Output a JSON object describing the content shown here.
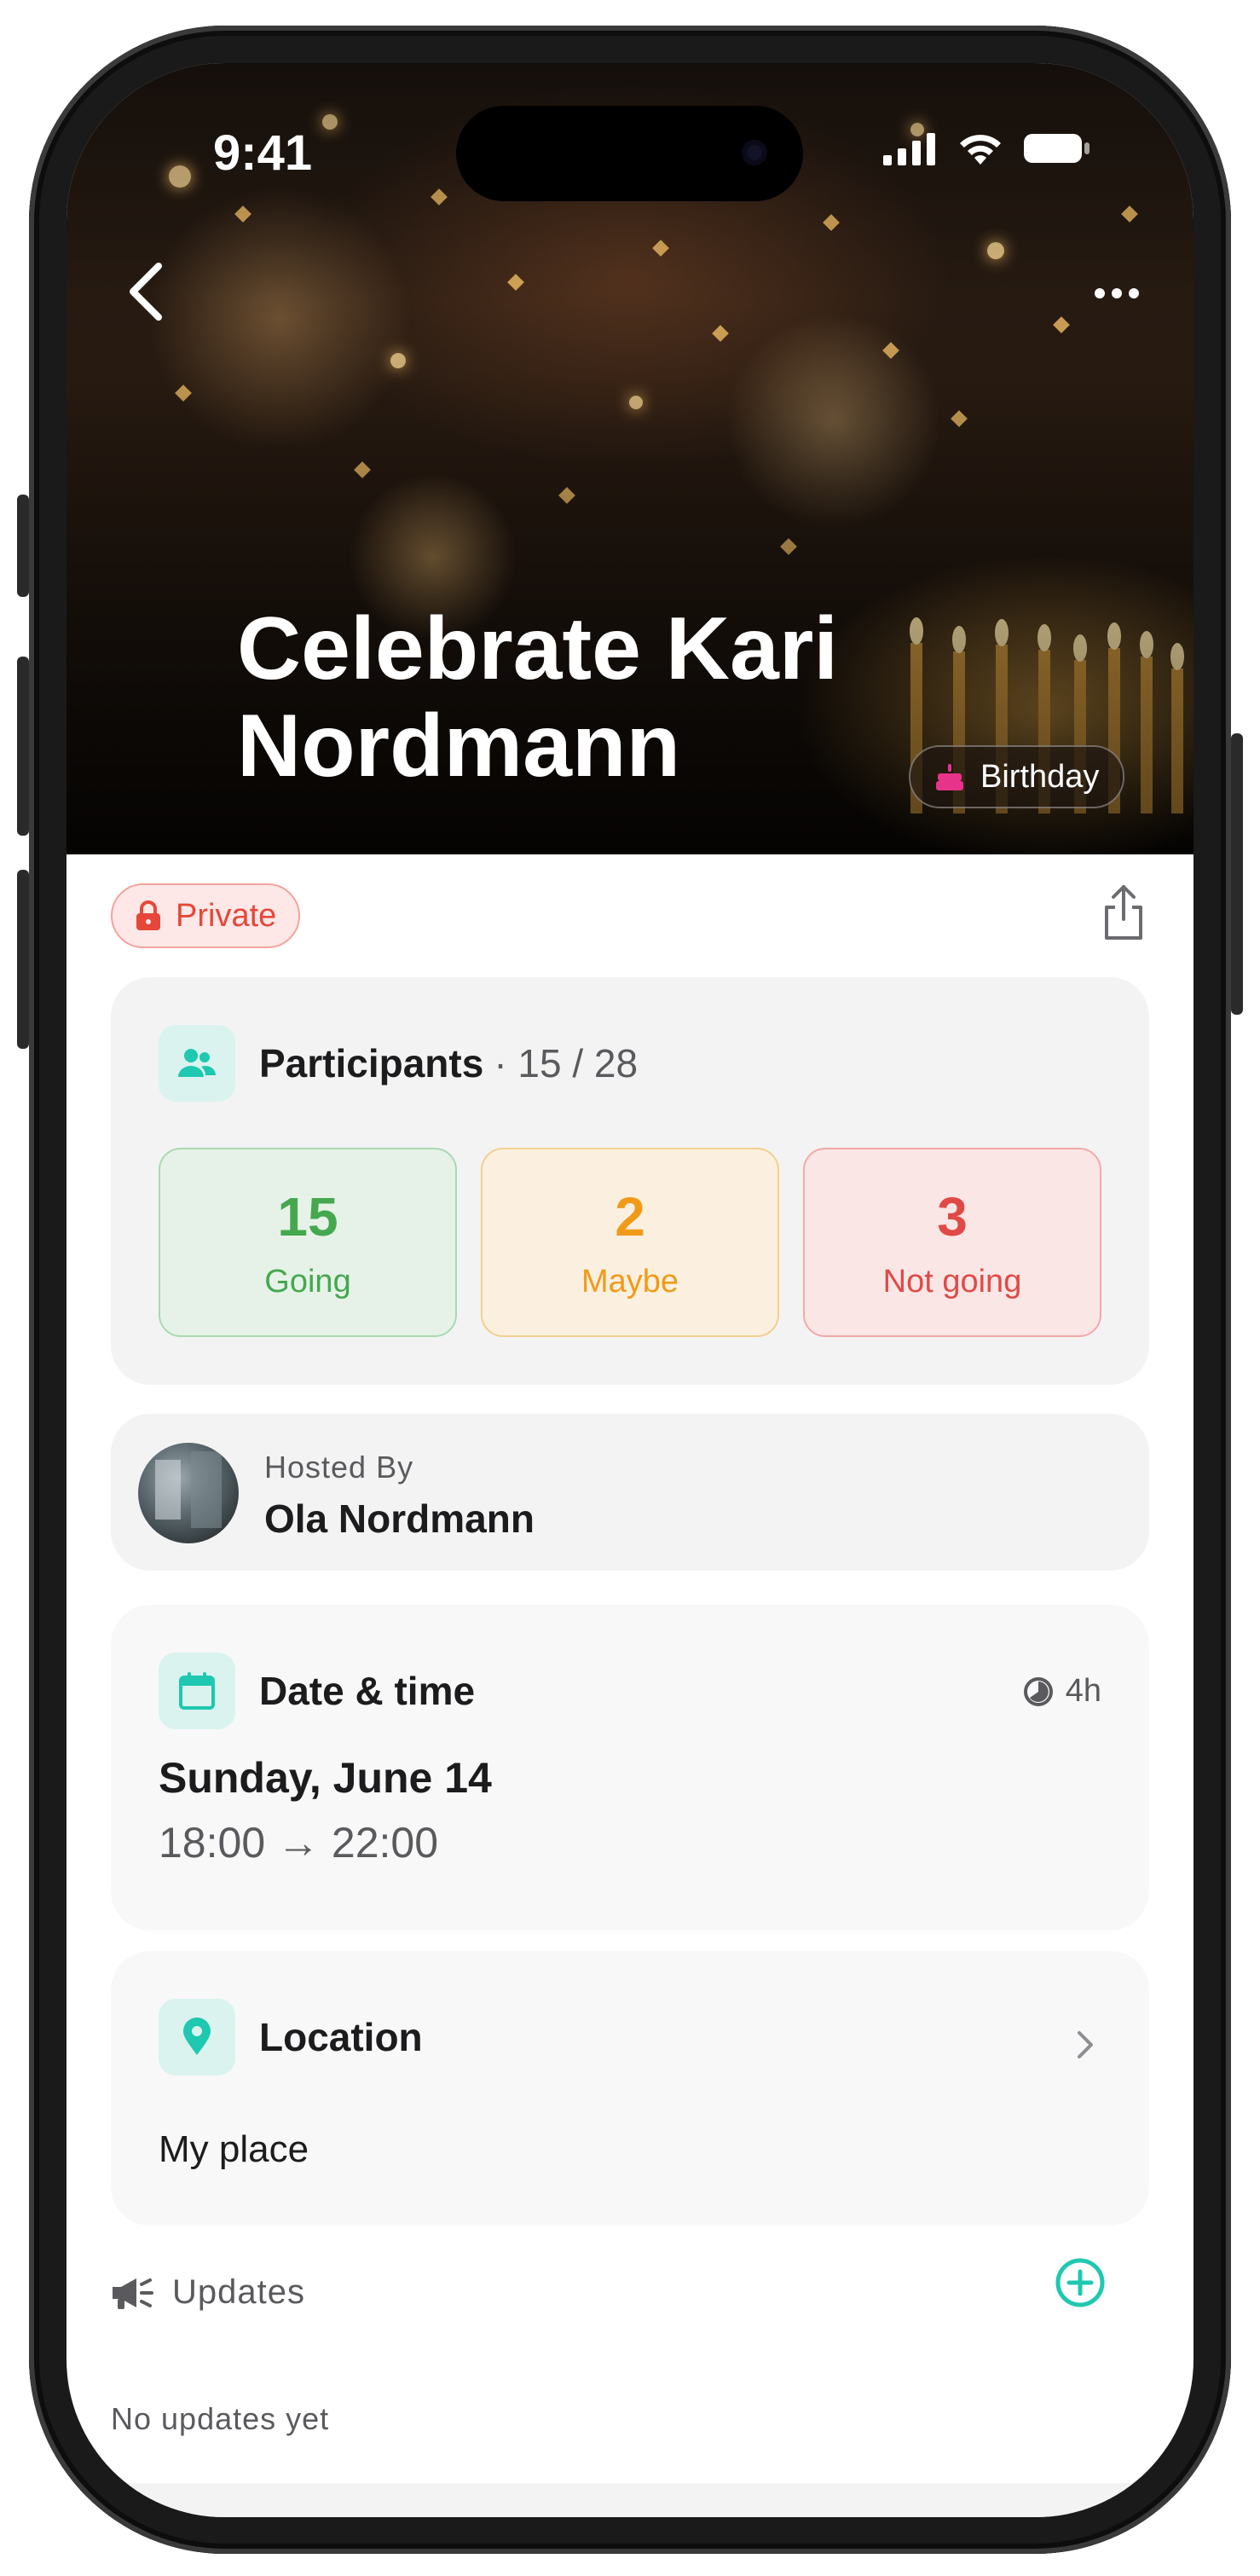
{
  "status_bar": {
    "time": "9:41"
  },
  "hero": {
    "title": "Celebrate Kari Nordmann",
    "category": "Birthday"
  },
  "visibility": {
    "label": "Private"
  },
  "participants": {
    "title": "Participants",
    "count": "· 15 / 28",
    "going": {
      "value": "15",
      "label": "Going"
    },
    "maybe": {
      "value": "2",
      "label": "Maybe"
    },
    "not_going": {
      "value": "3",
      "label": "Not going"
    }
  },
  "host": {
    "label": "Hosted By",
    "name": "Ola Nordmann"
  },
  "date_time": {
    "title": "Date & time",
    "duration": "4h",
    "date": "Sunday, June 14",
    "time_range": "18:00 → 22:00"
  },
  "location": {
    "title": "Location",
    "value": "My place"
  },
  "updates": {
    "title": "Updates",
    "empty_text": "No updates yet"
  },
  "colors": {
    "accent": "#1fc8b0",
    "private_red": "#e5473a",
    "going_green": "#45a84f",
    "maybe_orange": "#f19a1a",
    "not_going_red": "#e04a46",
    "birthday_pink": "#e8338a"
  },
  "icons": {
    "back": "chevron-left-icon",
    "more": "ellipsis-icon",
    "birthday": "cake-icon",
    "private": "lock-icon",
    "share": "share-icon",
    "participants": "people-icon",
    "date": "calendar-icon",
    "duration": "clock-icon",
    "location": "map-pin-icon",
    "updates": "megaphone-icon",
    "add_update": "plus-circle-icon"
  }
}
